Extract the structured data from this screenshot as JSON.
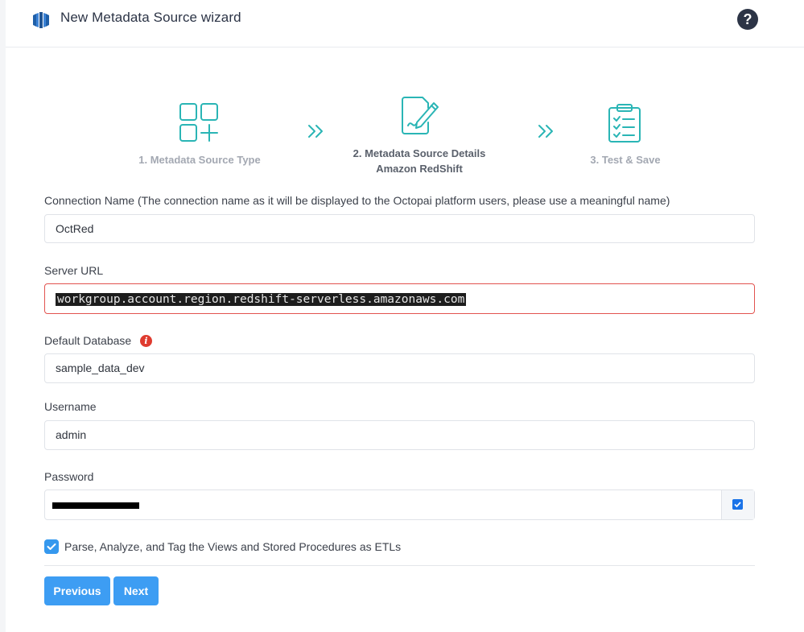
{
  "header": {
    "title": "New Metadata Source wizard",
    "help_label": "?"
  },
  "steps": [
    {
      "label": "1. Metadata Source Type",
      "icon": "add-tiles-icon",
      "state": "done"
    },
    {
      "label": "2. Metadata Source Details",
      "sub": "Amazon RedShift",
      "icon": "edit-document-icon",
      "state": "active"
    },
    {
      "label": "3. Test & Save",
      "icon": "clipboard-checklist-icon",
      "state": "pending"
    }
  ],
  "form": {
    "connection_name": {
      "label": "Connection Name (The connection name as it will be displayed to the Octopai platform users, please use a meaningful name)",
      "value": "OctRed"
    },
    "server_url": {
      "label": "Server URL",
      "value": "workgroup.account.region.redshift-serverless.amazonaws.com"
    },
    "default_database": {
      "label": "Default Database",
      "value": "sample_data_dev"
    },
    "username": {
      "label": "Username",
      "value": "admin"
    },
    "password": {
      "label": "Password"
    },
    "etl_option": {
      "label": "Parse, Analyze, and Tag the Views and Stored Procedures as ETLs",
      "checked": true
    }
  },
  "buttons": {
    "previous": "Previous",
    "next": "Next"
  },
  "colors": {
    "accent": "#3d9df3",
    "step_icon": "#2ab5b5",
    "error_border": "#e2534f",
    "title": "#2c3446"
  }
}
